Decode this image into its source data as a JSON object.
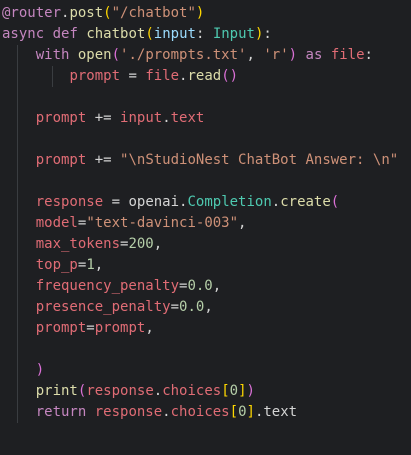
{
  "editor": {
    "language": "python",
    "theme_background": "#1e1f22",
    "lines": [
      "@router.post(\"/chatbot\")",
      "async def chatbot(input: Input):",
      "    with open('./prompts.txt', 'r') as file:",
      "        prompt = file.read()",
      "",
      "    prompt += input.text",
      "",
      "    prompt += \"\\nStudioNest ChatBot Answer: \\n\"",
      "",
      "    response = openai.Completion.create(",
      "    model=\"text-davinci-003\",",
      "    max_tokens=200,",
      "    top_p=1,",
      "    frequency_penalty=0.0,",
      "    presence_penalty=0.0,",
      "    prompt=prompt,",
      "",
      "    )",
      "    print(response.choices[0])",
      "    return response.choices[0].text"
    ]
  },
  "tokens": {
    "l1": {
      "decorator": "@router",
      "dot": ".",
      "post": "post",
      "open": "(",
      "str": "\"/chatbot\"",
      "close": ")"
    },
    "l2": {
      "async": "async",
      "def": "def",
      "name": "chatbot",
      "open": "(",
      "param": "input",
      "colon": ":",
      "type": "Input",
      "close": ")",
      "end": ":"
    },
    "l3": {
      "with": "with",
      "open_fn": "open",
      "p1": "(",
      "s1": "'./prompts.txt'",
      "comma": ",",
      "s2": "'r'",
      "p2": ")",
      "as": "as",
      "file": "file",
      "end": ":"
    },
    "l4": {
      "prompt": "prompt",
      "eq": "=",
      "file": "file",
      "dot": ".",
      "read": "read",
      "parens": "()"
    },
    "l6": {
      "prompt": "prompt",
      "op": "+=",
      "input": "input",
      "dot": ".",
      "text": "text"
    },
    "l8": {
      "prompt": "prompt",
      "op": "+=",
      "str": "\"\\nStudioNest ChatBot Answer: \\n\""
    },
    "l10": {
      "response": "response",
      "eq": "=",
      "openai": "openai",
      "dot1": ".",
      "completion": "Completion",
      "dot2": ".",
      "create": "create",
      "open": "("
    },
    "l11": {
      "key": "model",
      "eq": "=",
      "val": "\"text-davinci-003\"",
      "comma": ","
    },
    "l12": {
      "key": "max_tokens",
      "eq": "=",
      "val": "200",
      "comma": ","
    },
    "l13": {
      "key": "top_p",
      "eq": "=",
      "val": "1",
      "comma": ","
    },
    "l14": {
      "key": "frequency_penalty",
      "eq": "=",
      "val": "0.0",
      "comma": ","
    },
    "l15": {
      "key": "presence_penalty",
      "eq": "=",
      "val": "0.0",
      "comma": ","
    },
    "l16": {
      "key": "prompt",
      "eq": "=",
      "val": "prompt",
      "comma": ","
    },
    "l18": {
      "close": ")"
    },
    "l19": {
      "print": "print",
      "open": "(",
      "response": "response",
      "dot": ".",
      "choices": "choices",
      "bopen": "[",
      "idx": "0",
      "bclose": "]",
      "close": ")"
    },
    "l20": {
      "return": "return",
      "response": "response",
      "dot": ".",
      "choices": "choices",
      "bopen": "[",
      "idx": "0",
      "bclose": "]",
      "dot2": ".",
      "text": "text"
    }
  }
}
